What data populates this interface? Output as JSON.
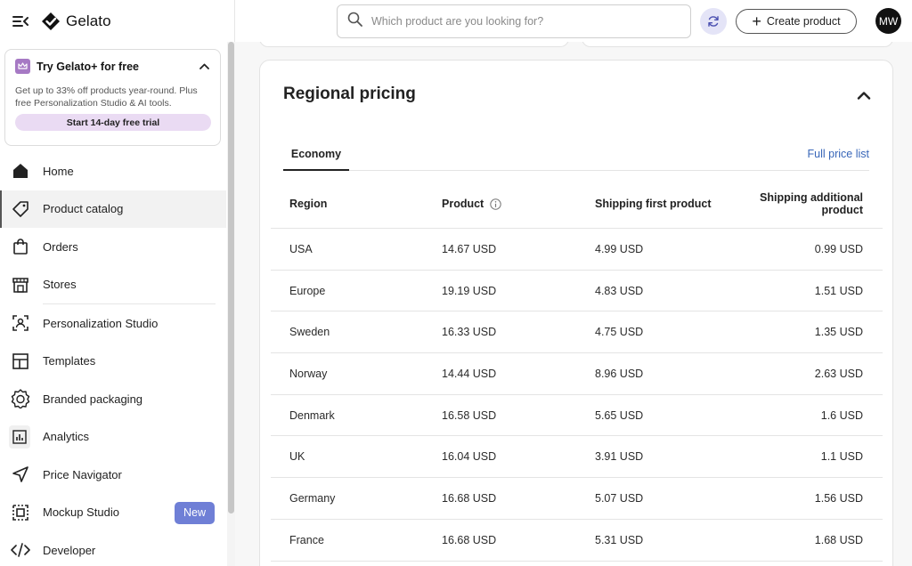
{
  "brand": {
    "name": "Gelato"
  },
  "promo": {
    "title": "Try Gelato+ for free",
    "description": "Get up to 33% off products year-round. Plus free Personalization Studio & AI tools.",
    "button_label": "Start 14-day free trial"
  },
  "sidebar": {
    "items": [
      {
        "label": "Home",
        "icon": "home-icon"
      },
      {
        "label": "Product catalog",
        "icon": "tag-icon",
        "active": true
      },
      {
        "label": "Orders",
        "icon": "shopping-bag-icon"
      },
      {
        "label": "Stores",
        "icon": "storefront-icon"
      },
      {
        "label": "Personalization Studio",
        "icon": "personalization-icon"
      },
      {
        "label": "Templates",
        "icon": "template-layout-icon"
      },
      {
        "label": "Branded packaging",
        "icon": "badge-rosette-icon"
      },
      {
        "label": "Analytics",
        "icon": "chart-icon"
      },
      {
        "label": "Price Navigator",
        "icon": "navigation-arrow-icon"
      },
      {
        "label": "Mockup Studio",
        "icon": "mockup-frame-icon",
        "badge": "New"
      },
      {
        "label": "Developer",
        "icon": "code-icon"
      }
    ]
  },
  "topbar": {
    "search_placeholder": "Which product are you looking for?",
    "create_label": "Create product",
    "avatar_initials": "MW"
  },
  "regional_pricing": {
    "title": "Regional pricing",
    "tabs": [
      {
        "label": "Economy",
        "active": true
      }
    ],
    "full_price_link": "Full price list",
    "columns": [
      "Region",
      "Product",
      "Shipping first product",
      "Shipping additional product"
    ],
    "rows": [
      [
        "USA",
        "14.67 USD",
        "4.99 USD",
        "0.99 USD"
      ],
      [
        "Europe",
        "19.19 USD",
        "4.83 USD",
        "1.51 USD"
      ],
      [
        "Sweden",
        "16.33 USD",
        "4.75 USD",
        "1.35 USD"
      ],
      [
        "Norway",
        "14.44 USD",
        "8.96 USD",
        "2.63 USD"
      ],
      [
        "Denmark",
        "16.58 USD",
        "5.65 USD",
        "1.6 USD"
      ],
      [
        "UK",
        "16.04 USD",
        "3.91 USD",
        "1.1 USD"
      ],
      [
        "Germany",
        "16.68 USD",
        "5.07 USD",
        "1.56 USD"
      ],
      [
        "France",
        "16.68 USD",
        "5.31 USD",
        "1.68 USD"
      ]
    ]
  },
  "colors": {
    "accent_badge": "#6f7fd6",
    "promo_button": "#eadbf3",
    "link": "#3866b8",
    "sync_button": "#e4e4f7"
  }
}
